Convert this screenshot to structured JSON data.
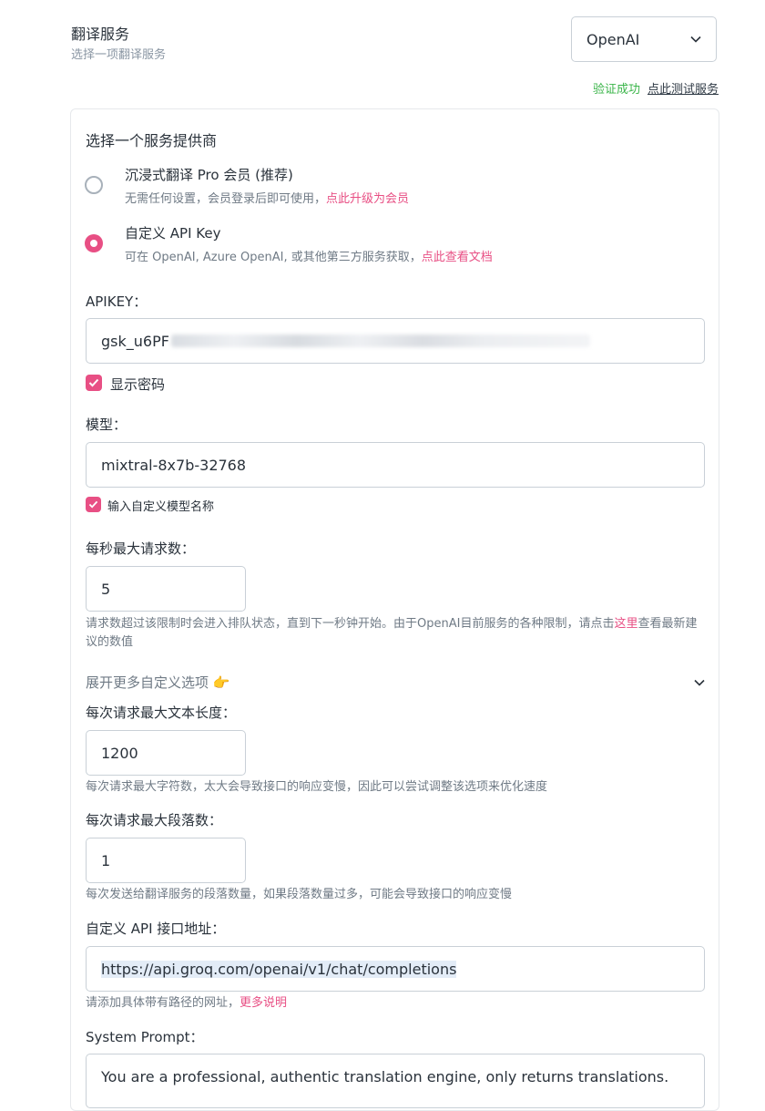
{
  "header": {
    "title": "翻译服务",
    "subtitle": "选择一项翻译服务",
    "selected_service": "OpenAI",
    "verify_status": "验证成功",
    "test_link": "点此测试服务"
  },
  "provider": {
    "label": "选择一个服务提供商",
    "options": [
      {
        "title": "沉浸式翻译 Pro 会员 (推荐)",
        "desc": "无需任何设置，会员登录后即可使用，",
        "link": "点此升级为会员",
        "selected": false
      },
      {
        "title": "自定义 API Key",
        "desc": "可在 OpenAI, Azure OpenAI, 或其他第三方服务获取，",
        "link": "点此查看文档",
        "selected": true
      }
    ]
  },
  "apikey": {
    "label": "APIKEY：",
    "value_visible": "gsk_u6PF",
    "show_password_label": "显示密码",
    "show_password_checked": true
  },
  "model": {
    "label": "模型：",
    "value": "mixtral-8x7b-32768",
    "custom_label": "输入自定义模型名称",
    "custom_checked": true
  },
  "rate": {
    "label": "每秒最大请求数：",
    "value": "5",
    "help_pre": "请求数超过该限制时会进入排队状态，直到下一秒钟开始。由于OpenAI目前服务的各种限制，请点击",
    "help_link": "这里",
    "help_post": "查看最新建议的数值"
  },
  "expand": {
    "label": "展开更多自定义选项 👉"
  },
  "max_text": {
    "label": "每次请求最大文本长度：",
    "value": "1200",
    "help": "每次请求最大字符数，太大会导致接口的响应变慢，因此可以尝试调整该选项来优化速度"
  },
  "max_para": {
    "label": "每次请求最大段落数：",
    "value": "1",
    "help": "每次发送给翻译服务的段落数量，如果段落数量过多，可能会导致接口的响应变慢"
  },
  "api_url": {
    "label": "自定义 API 接口地址：",
    "value": "https://api.groq.com/openai/v1/chat/completions",
    "help": "请添加具体带有路径的网址，",
    "help_link": "更多说明"
  },
  "system_prompt": {
    "label": "System Prompt：",
    "value": "You are a professional, authentic translation engine, only returns translations."
  },
  "icons": {
    "chevron": "chevron-down-icon",
    "check": "check-icon",
    "radio": "radio-icon"
  },
  "colors": {
    "accent": "#e84f84",
    "success": "#3bb54a",
    "border": "#c9d0d7"
  }
}
